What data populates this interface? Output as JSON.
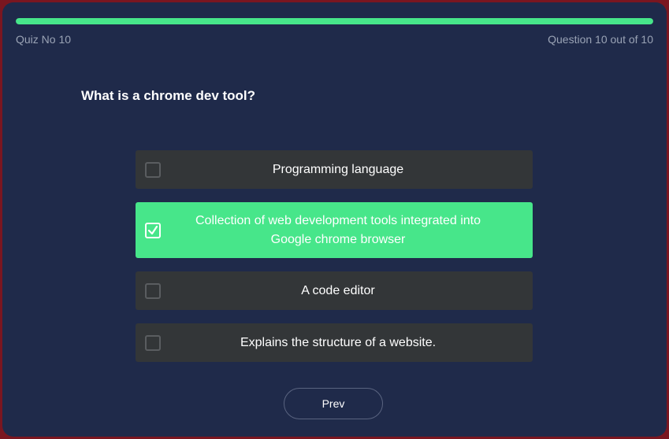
{
  "progress": {
    "fraction": 1.0
  },
  "quiz": {
    "label": "Quiz No 10",
    "counter": "Question 10 out of 10"
  },
  "question": {
    "text": "What is a chrome dev tool?"
  },
  "options": [
    {
      "text": "Programming language",
      "selected": false
    },
    {
      "text": "Collection of web development tools integrated into Google chrome browser",
      "selected": true
    },
    {
      "text": "A code editor",
      "selected": false
    },
    {
      "text": "Explains the structure of a website.",
      "selected": false
    }
  ],
  "nav": {
    "prev_label": "Prev"
  },
  "colors": {
    "accent": "#47e68a",
    "background": "#1f2a4a",
    "option_bg": "#333638",
    "frame": "#7a1620"
  },
  "icons": {
    "selected_mark": "checkmark-icon"
  }
}
